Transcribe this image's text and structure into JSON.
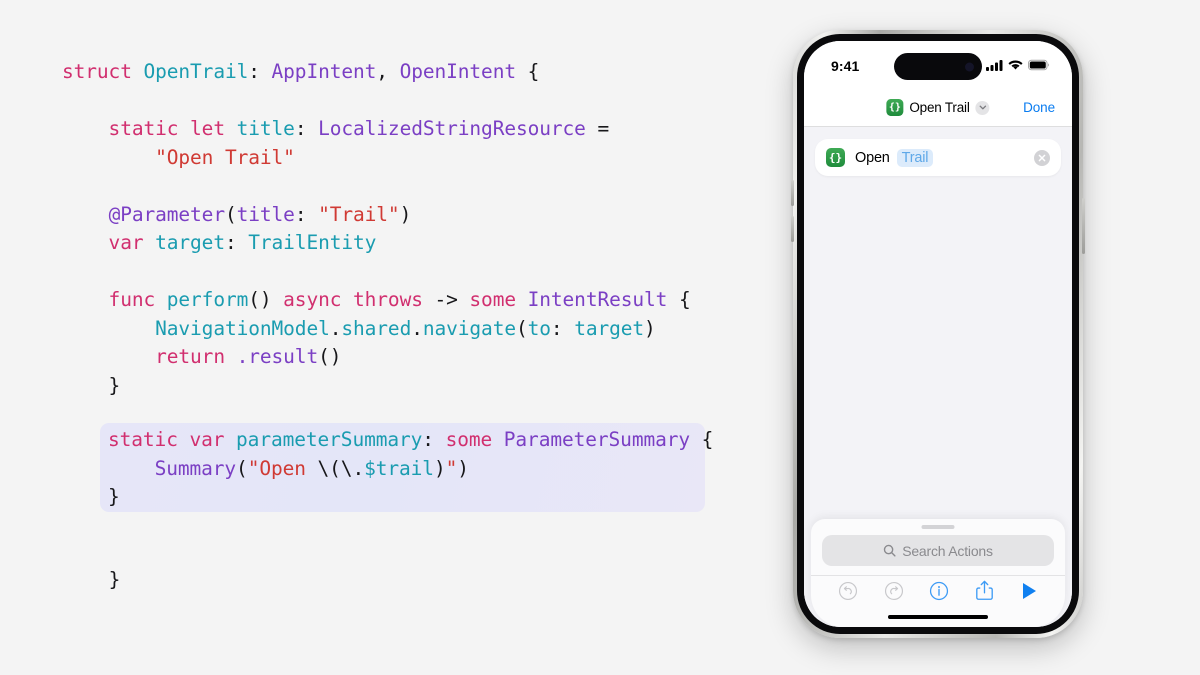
{
  "code": {
    "lines": [
      [
        {
          "t": "struct ",
          "c": "kw"
        },
        {
          "t": "OpenTrail",
          "c": "tea"
        },
        {
          "t": ": ",
          "c": "pln"
        },
        {
          "t": "AppIntent",
          "c": "typ"
        },
        {
          "t": ", ",
          "c": "pln"
        },
        {
          "t": "OpenIntent",
          "c": "typ"
        },
        {
          "t": " {",
          "c": "pln"
        }
      ],
      [],
      [
        {
          "t": "    static let ",
          "c": "kw"
        },
        {
          "t": "title",
          "c": "tea"
        },
        {
          "t": ": ",
          "c": "pln"
        },
        {
          "t": "LocalizedStringResource",
          "c": "typ"
        },
        {
          "t": " =",
          "c": "pln"
        }
      ],
      [
        {
          "t": "        ",
          "c": "pln"
        },
        {
          "t": "\"Open Trail\"",
          "c": "str"
        }
      ],
      [],
      [
        {
          "t": "    ",
          "c": "pln"
        },
        {
          "t": "@Parameter",
          "c": "attr"
        },
        {
          "t": "(",
          "c": "pln"
        },
        {
          "t": "title",
          "c": "typ"
        },
        {
          "t": ": ",
          "c": "pln"
        },
        {
          "t": "\"Trail\"",
          "c": "str"
        },
        {
          "t": ")",
          "c": "pln"
        }
      ],
      [
        {
          "t": "    var ",
          "c": "kw"
        },
        {
          "t": "target",
          "c": "tea"
        },
        {
          "t": ": ",
          "c": "pln"
        },
        {
          "t": "TrailEntity",
          "c": "tea"
        }
      ],
      [],
      [
        {
          "t": "    func ",
          "c": "kw"
        },
        {
          "t": "perform",
          "c": "tea"
        },
        {
          "t": "() ",
          "c": "pln"
        },
        {
          "t": "async throws ",
          "c": "kw"
        },
        {
          "t": "-> ",
          "c": "pln"
        },
        {
          "t": "some ",
          "c": "kw"
        },
        {
          "t": "IntentResult",
          "c": "typ"
        },
        {
          "t": " {",
          "c": "pln"
        }
      ],
      [
        {
          "t": "        ",
          "c": "pln"
        },
        {
          "t": "NavigationModel",
          "c": "tea"
        },
        {
          "t": ".",
          "c": "pln"
        },
        {
          "t": "shared",
          "c": "tea"
        },
        {
          "t": ".",
          "c": "pln"
        },
        {
          "t": "navigate",
          "c": "tea"
        },
        {
          "t": "(",
          "c": "pln"
        },
        {
          "t": "to",
          "c": "tea"
        },
        {
          "t": ": ",
          "c": "pln"
        },
        {
          "t": "target",
          "c": "tea"
        },
        {
          "t": ")",
          "c": "pln"
        }
      ],
      [
        {
          "t": "        return ",
          "c": "kw"
        },
        {
          "t": ".result",
          "c": "met"
        },
        {
          "t": "()",
          "c": "pln"
        }
      ],
      [
        {
          "t": "    }",
          "c": "pln"
        }
      ],
      []
    ],
    "highlighted_lines": [
      [
        {
          "t": "static var ",
          "c": "kw"
        },
        {
          "t": "parameterSummary",
          "c": "tea"
        },
        {
          "t": ": ",
          "c": "pln"
        },
        {
          "t": "some ",
          "c": "kw"
        },
        {
          "t": "ParameterSummary",
          "c": "typ"
        },
        {
          "t": " {",
          "c": "pln"
        }
      ],
      [
        {
          "t": "    ",
          "c": "pln"
        },
        {
          "t": "Summary",
          "c": "met"
        },
        {
          "t": "(",
          "c": "pln"
        },
        {
          "t": "\"Open ",
          "c": "str"
        },
        {
          "t": "\\(\\.",
          "c": "pln"
        },
        {
          "t": "$trail",
          "c": "tea"
        },
        {
          "t": ")",
          "c": "pln"
        },
        {
          "t": "\"",
          "c": "str"
        },
        {
          "t": ")",
          "c": "pln"
        }
      ],
      [
        {
          "t": "}",
          "c": "pln"
        }
      ]
    ],
    "closing_brace": "}"
  },
  "phone": {
    "status_bar": {
      "time": "9:41",
      "cellular_icon": "cellular-bars-icon",
      "wifi_icon": "wifi-icon",
      "battery_icon": "battery-full-icon"
    },
    "nav_bar": {
      "app_icon_glyph": "{}",
      "title": "Open Trail",
      "chevron_icon": "chevron-down-icon",
      "done_label": "Done"
    },
    "action_card": {
      "app_icon_glyph": "{}",
      "action_label": "Open",
      "token_label": "Trail",
      "clear_icon": "clear-x-icon"
    },
    "sheet": {
      "search_placeholder": "Search Actions",
      "search_icon": "search-icon",
      "toolbar": [
        {
          "name": "undo-button",
          "icon": "undo-icon",
          "state": "disabled"
        },
        {
          "name": "redo-button",
          "icon": "redo-icon",
          "state": "disabled"
        },
        {
          "name": "info-button",
          "icon": "info-circle-icon",
          "state": "enabled"
        },
        {
          "name": "share-button",
          "icon": "share-icon",
          "state": "enabled"
        },
        {
          "name": "run-button",
          "icon": "play-icon",
          "state": "enabled"
        }
      ]
    }
  },
  "colors": {
    "page_background": "#f4f4f4",
    "keyword": "#d12f6f",
    "type": "#7b3fc4",
    "identifier": "#1a9cb0",
    "string": "#d03a34",
    "plain": "#17171a",
    "highlight_background": "#e6e6f8",
    "ios_blue": "#0a7cf0",
    "icon_green": "#1f8c3c",
    "token_blue": "#5fa8e8",
    "disabled_gray": "#c3c3c6"
  }
}
